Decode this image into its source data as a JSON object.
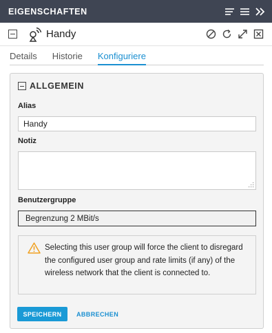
{
  "window": {
    "title": "EIGENSCHAFTEN",
    "icons": [
      "sort-lines-icon",
      "menu-icon",
      "double-chevron-right-icon"
    ]
  },
  "header": {
    "device_name": "Handy",
    "device_icon": "wireless-client-icon",
    "actions": [
      "block-icon",
      "refresh-icon",
      "expand-icon",
      "close-box-icon"
    ]
  },
  "tabs": [
    {
      "label": "Details",
      "active": false
    },
    {
      "label": "Historie",
      "active": false
    },
    {
      "label": "Konfiguriere",
      "active": true
    }
  ],
  "section": {
    "title": "ALLGEMEIN"
  },
  "form": {
    "alias_label": "Alias",
    "alias_value": "Handy",
    "note_label": "Notiz",
    "note_value": "",
    "usergroup_label": "Benutzergruppe",
    "usergroup_value": "Begrenzung 2 MBit/s"
  },
  "warning": {
    "icon": "warning-triangle-icon",
    "text": "Selecting this user group will force the client to disregard the configured user group and rate limits (if any) of the wireless network that the client is connected to."
  },
  "buttons": {
    "save": "SPEICHERN",
    "cancel": "ABBRECHEN"
  },
  "colors": {
    "titlebar_bg": "#3f4553",
    "accent": "#1a9ad6",
    "warning": "#f0a020"
  }
}
